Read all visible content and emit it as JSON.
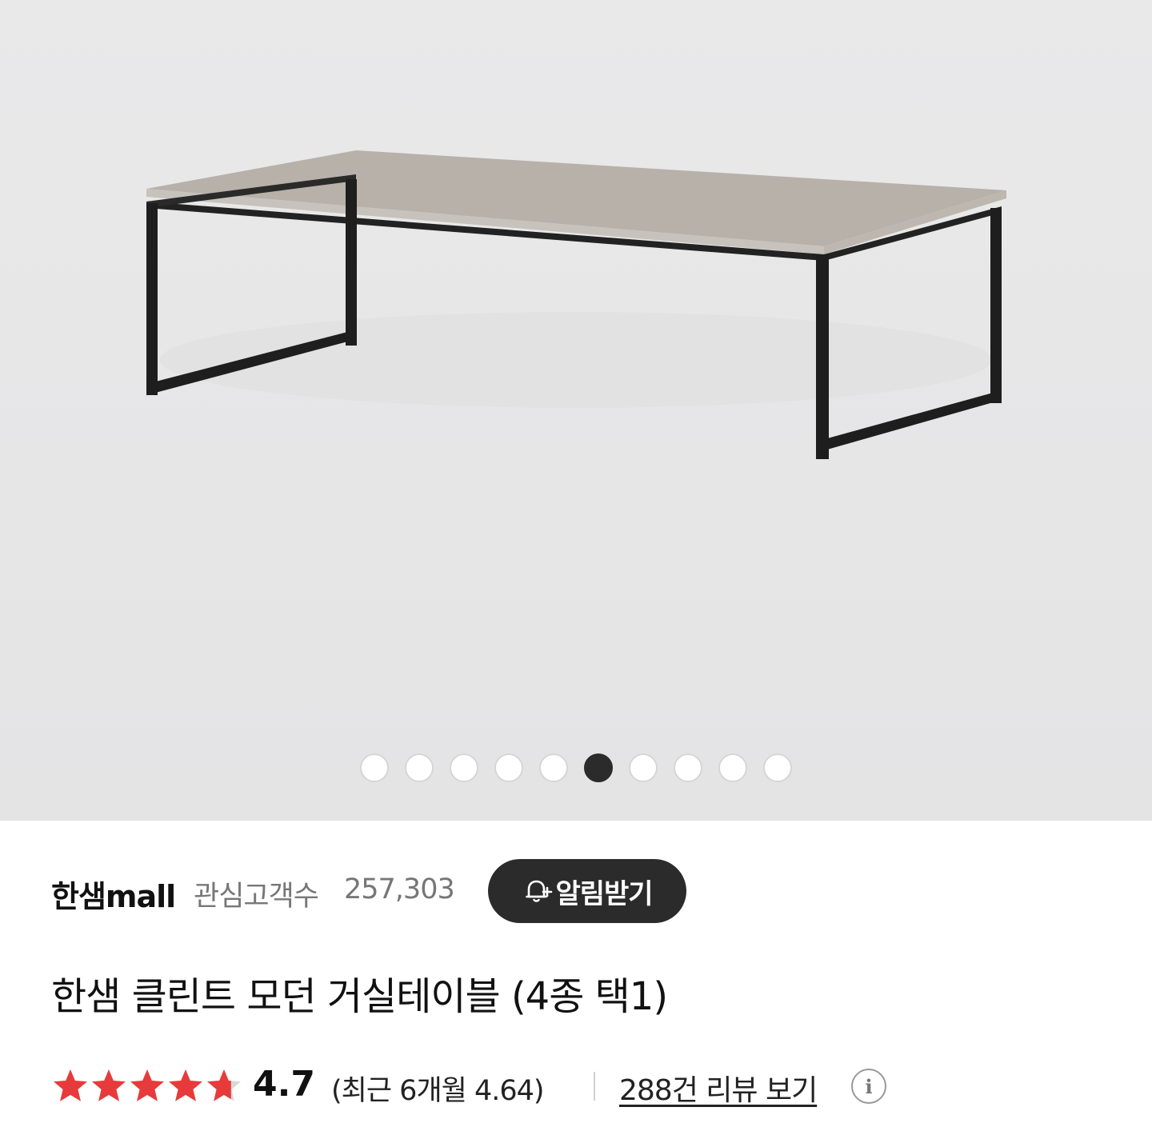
{
  "gallery": {
    "image_name": "coffee-table-image",
    "slide_count": 10,
    "active_slide": 6
  },
  "seller": {
    "name": "한샘mall",
    "follower_label": "관심고객수",
    "follower_count": "257,303",
    "notify_label": "알림받기",
    "notify_icon": "bell-plus-icon"
  },
  "product": {
    "title": "한샘 클린트 모던 거실테이블 (4종 택1)"
  },
  "rating": {
    "score": "4.7",
    "score_value": 4.7,
    "max": 5,
    "star_color": "#e83a3a",
    "recent": "(최근 6개월 4.64)",
    "review_link": "288건 리뷰 보기",
    "info_icon": "info-icon"
  }
}
